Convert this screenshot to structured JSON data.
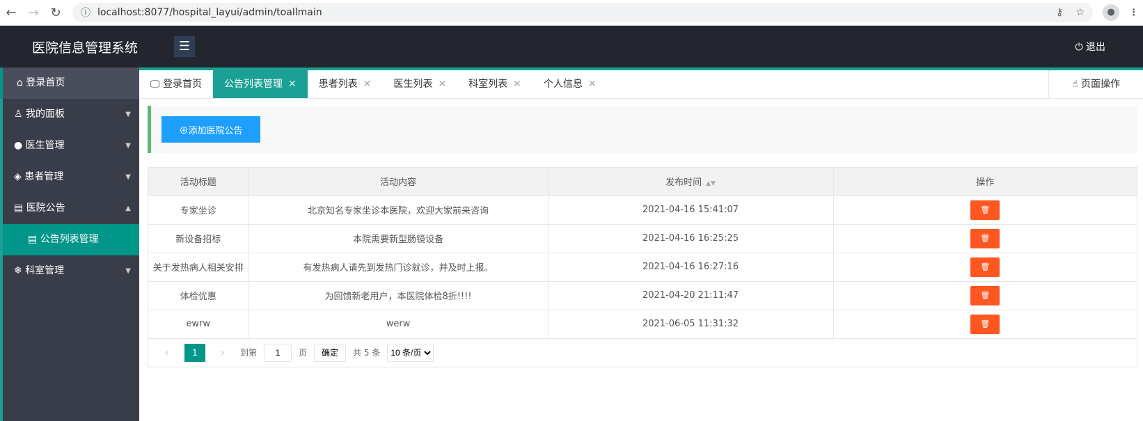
{
  "browser": {
    "url": "localhost:8077/hospital_layui/admin/toallmain"
  },
  "header": {
    "title": "医院信息管理系统",
    "logout": "退出"
  },
  "sidebar": {
    "items": [
      {
        "label": "登录首页",
        "icon": "⌂"
      },
      {
        "label": "我的面板",
        "icon": "♙"
      },
      {
        "label": "医生管理",
        "icon": "●"
      },
      {
        "label": "患者管理",
        "icon": "◈"
      },
      {
        "label": "医院公告",
        "icon": "▤"
      },
      {
        "label": "公告列表管理",
        "icon": "▤"
      },
      {
        "label": "科室管理",
        "icon": "❄"
      }
    ]
  },
  "tabs": [
    {
      "label": "登录首页"
    },
    {
      "label": "公告列表管理"
    },
    {
      "label": "患者列表"
    },
    {
      "label": "医生列表"
    },
    {
      "label": "科室列表"
    },
    {
      "label": "个人信息"
    }
  ],
  "page_ops": "页面操作",
  "toolbar": {
    "add_label": "添加医院公告"
  },
  "table": {
    "headers": [
      "活动标题",
      "活动内容",
      "发布时间",
      "操作"
    ],
    "rows": [
      [
        "专家坐诊",
        "北京知名专家坐诊本医院，欢迎大家前来咨询",
        "2021-04-16 15:41:07"
      ],
      [
        "新设备招标",
        "本院需要新型肠镜设备",
        "2021-04-16 16:25:25"
      ],
      [
        "关于发热病人相关安排",
        "有发热病人请先到发热门诊就诊，并及时上报。",
        "2021-04-16 16:27:16"
      ],
      [
        "体检优惠",
        "为回馈新老用户，本医院体检8折!!!!",
        "2021-04-20 21:11:47"
      ],
      [
        "ewrw",
        "werw",
        "2021-06-05 11:31:32"
      ]
    ]
  },
  "pager": {
    "current": "1",
    "goto_label": "到第",
    "page_input": "1",
    "page_label": "页",
    "confirm": "确定",
    "total": "共 5 条",
    "page_size": "10 条/页"
  }
}
